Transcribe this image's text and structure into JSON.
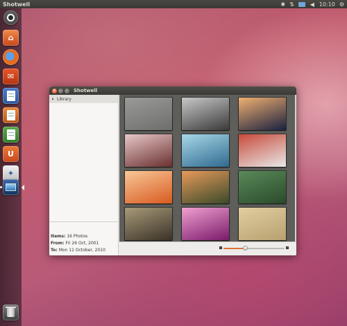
{
  "top_panel": {
    "app_title": "Shotwell",
    "clock": "10:10",
    "indicators": [
      "bluetooth-icon",
      "network-icon",
      "mail-icon",
      "volume-icon",
      "clock",
      "session-gear-icon"
    ]
  },
  "launcher": {
    "items": [
      "dash-home",
      "home-folder",
      "firefox",
      "thunderbird-mail",
      "libreoffice-writer",
      "libreoffice-impress",
      "libreoffice-calc",
      "ubuntu-software-center",
      "thunderbird-bird",
      "shotwell",
      "trash"
    ],
    "active": "shotwell"
  },
  "window": {
    "title": "Shotwell",
    "sidebar": {
      "library_label": "Library"
    },
    "info": {
      "items_label": "Items:",
      "items_value": "16 Photos",
      "from_label": "From:",
      "from_value": "Fri 26 Oct, 2001",
      "to_label": "To:",
      "to_value": "Mon 11 October, 2010"
    },
    "photos": [
      {
        "name": "misty-deer",
        "colors": [
          "#9a9a98",
          "#6e6e6c"
        ]
      },
      {
        "name": "gears-closeup",
        "colors": [
          "#c8c8c8",
          "#3a3a3a"
        ]
      },
      {
        "name": "sunset-horizon",
        "colors": [
          "#f0b070",
          "#1a2040"
        ]
      },
      {
        "name": "pink-blossoms",
        "colors": [
          "#e8c8c8",
          "#6a3030"
        ]
      },
      {
        "name": "blue-water",
        "colors": [
          "#a8d8e8",
          "#306a90"
        ]
      },
      {
        "name": "red-trees-path",
        "colors": [
          "#c84a3a",
          "#e8e8e8"
        ]
      },
      {
        "name": "orange-leaves",
        "colors": [
          "#f8c898",
          "#d85a20"
        ]
      },
      {
        "name": "valley-landscape",
        "colors": [
          "#e89a5a",
          "#3a4a2a"
        ]
      },
      {
        "name": "red-flowers-field",
        "colors": [
          "#5a8a5a",
          "#2a4a2a"
        ]
      },
      {
        "name": "fountain-pen",
        "colors": [
          "#a89a78",
          "#3a3228"
        ]
      },
      {
        "name": "pink-flower-macro",
        "colors": [
          "#f0a0d0",
          "#7a1a6a"
        ]
      },
      {
        "name": "sand-dunes",
        "colors": [
          "#e0cfa0",
          "#b8a070"
        ]
      }
    ],
    "zoom": {
      "level": 0.35
    }
  }
}
